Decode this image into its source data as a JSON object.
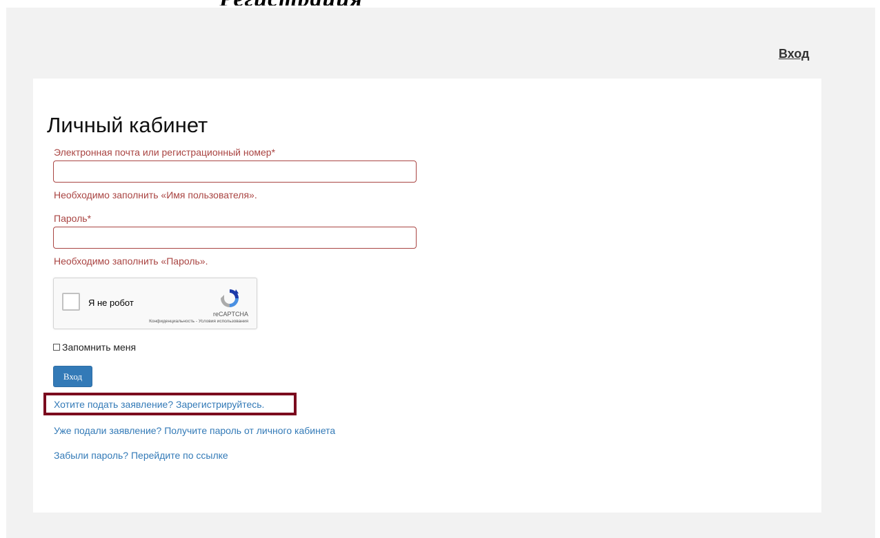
{
  "page_heading_partial": "Регистрация",
  "header": {
    "login_link": "Вход"
  },
  "card": {
    "title": "Личный кабинет",
    "email_field": {
      "label": "Электронная почта или регистрационный номер*",
      "value": "",
      "error": "Необходимо заполнить «Имя пользователя»."
    },
    "password_field": {
      "label": "Пароль*",
      "value": "",
      "error": "Необходимо заполнить «Пароль»."
    },
    "captcha": {
      "label": "Я не робот",
      "brand": "reCAPTCHA",
      "terms": "Конфиденциальность - Условия использования",
      "icon": "recaptcha-logo-icon"
    },
    "remember_me": {
      "label": "Запомнить меня",
      "checked": false
    },
    "submit_label": "Вход",
    "links": {
      "register": "Хотите подать заявление? Зарегистрируйтесь.",
      "get_password": "Уже подали заявление? Получите пароль от личного кабинета",
      "forgot_password": "Забыли пароль? Перейдите по ссылке"
    }
  },
  "colors": {
    "error": "#a94442",
    "link": "#337ab7",
    "button": "#337ab7",
    "highlight": "#7b0a1e",
    "background": "#f2f2f2"
  }
}
